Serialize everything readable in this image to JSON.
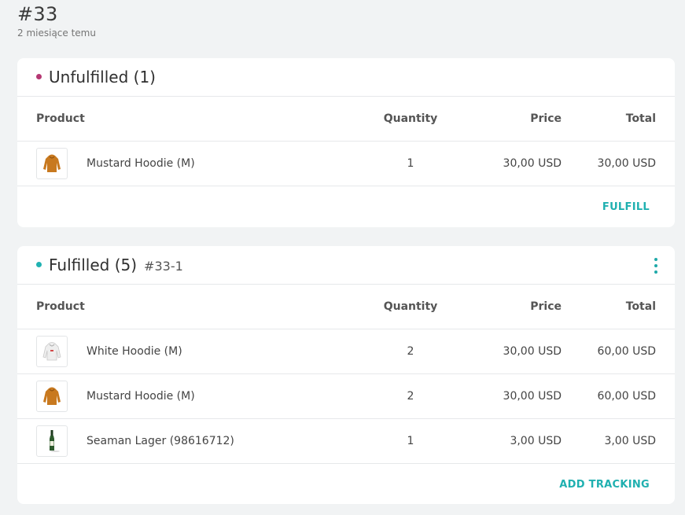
{
  "order": {
    "number": "#33",
    "time_ago": "2 miesiące temu"
  },
  "columns": {
    "product": "Product",
    "quantity": "Quantity",
    "price": "Price",
    "total": "Total"
  },
  "unfulfilled": {
    "title": "Unfulfilled (1)",
    "dot_color": "#b53873",
    "items": [
      {
        "name": "Mustard Hoodie (M)",
        "quantity": "1",
        "price": "30,00 USD",
        "total": "30,00 USD",
        "thumb_icon": "mustard-hoodie-icon"
      }
    ],
    "action_label": "FULFILL"
  },
  "fulfilled": {
    "title": "Fulfilled (5)",
    "subtitle": "#33-1",
    "dot_color": "#20b2b2",
    "items": [
      {
        "name": "White Hoodie (M)",
        "quantity": "2",
        "price": "30,00 USD",
        "total": "60,00 USD",
        "thumb_icon": "white-hoodie-icon"
      },
      {
        "name": "Mustard Hoodie (M)",
        "quantity": "2",
        "price": "30,00 USD",
        "total": "60,00 USD",
        "thumb_icon": "mustard-hoodie-icon"
      },
      {
        "name": "Seaman Lager (98616712)",
        "quantity": "1",
        "price": "3,00 USD",
        "total": "3,00 USD",
        "thumb_icon": "beer-bottle-icon"
      }
    ],
    "action_label": "ADD TRACKING"
  },
  "colors": {
    "accent": "#1fb0b0",
    "background": "#f1f3f4"
  }
}
